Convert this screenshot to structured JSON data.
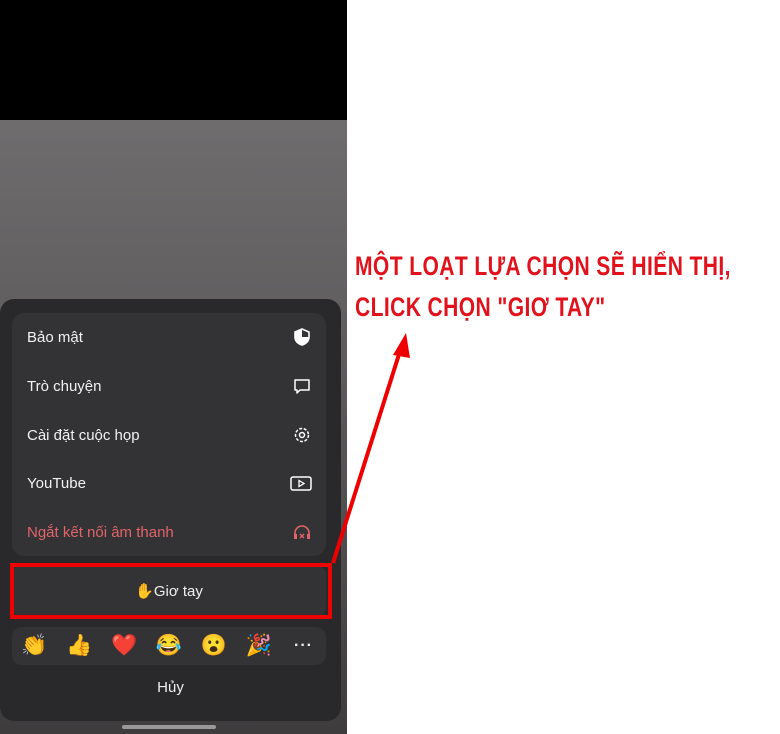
{
  "menu": {
    "items": [
      {
        "label": "Bảo mật",
        "icon": "shield-icon"
      },
      {
        "label": "Trò chuyện",
        "icon": "chat-bubble-icon"
      },
      {
        "label": "Cài đặt cuộc họp",
        "icon": "gear-icon"
      },
      {
        "label": "YouTube",
        "icon": "youtube-play-icon"
      },
      {
        "label": "Ngắt kết nối âm thanh",
        "icon": "headphones-disconnect-icon"
      }
    ]
  },
  "raise_hand": {
    "emoji": "✋",
    "label": "Giơ tay"
  },
  "reactions": [
    "👏",
    "👍",
    "❤️",
    "😂",
    "😮",
    "🎉"
  ],
  "more_label": "···",
  "cancel_label": "Hủy",
  "annotation": {
    "line1": "MỘT LOẠT LỰA CHỌN SẼ HIỂN THỊ,",
    "line2": "CLICK CHỌN \"GIƠ TAY\"",
    "color": "#e2121c"
  },
  "colors": {
    "danger": "#e0646a",
    "sheet": "#29292b"
  }
}
